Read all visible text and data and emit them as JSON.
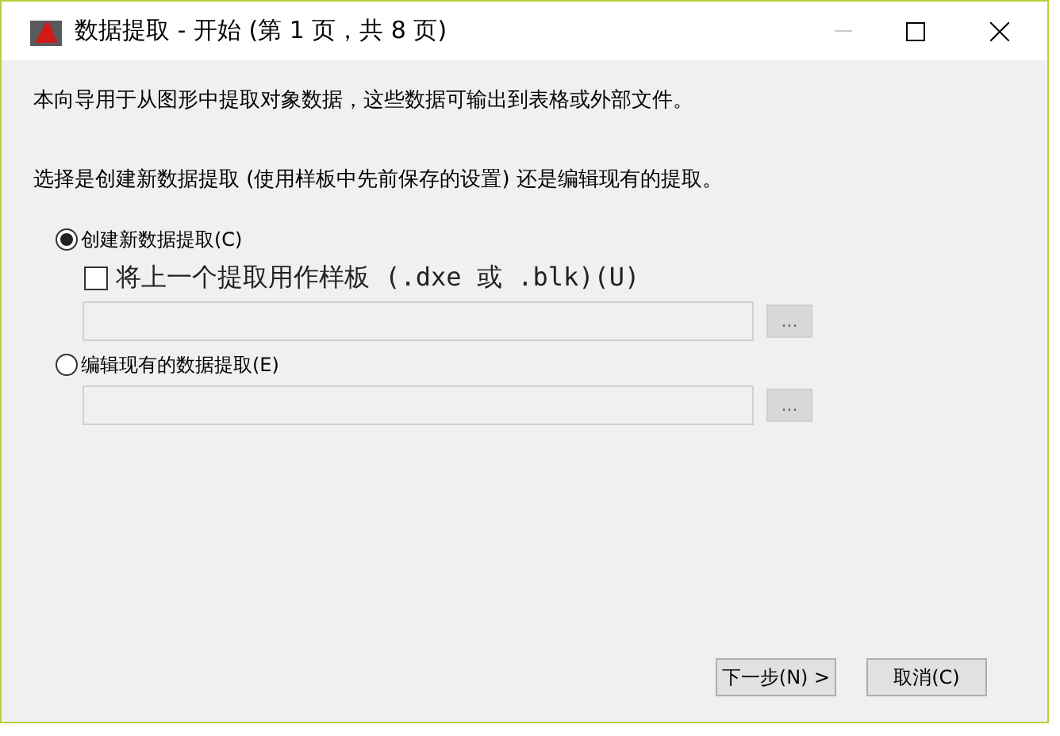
{
  "window": {
    "title": "数据提取 - 开始 (第 1 页，共 8 页)"
  },
  "intro": "本向导用于从图形中提取对象数据，这些数据可输出到表格或外部文件。",
  "prompt": "选择是创建新数据提取 (使用样板中先前保存的设置) 还是编辑现有的提取。",
  "options": [
    {
      "label": "创建新数据提取(C)",
      "selected": true,
      "sub": {
        "label": "将上一个提取用作样板 (.dxe 或 .blk)(U)",
        "checked": false
      },
      "field": {
        "browse": "..."
      }
    },
    {
      "label": "编辑现有的数据提取(E)",
      "selected": false,
      "field": {
        "browse": "..."
      }
    }
  ],
  "buttons": [
    "下一步(N) >",
    "取消(C)"
  ]
}
